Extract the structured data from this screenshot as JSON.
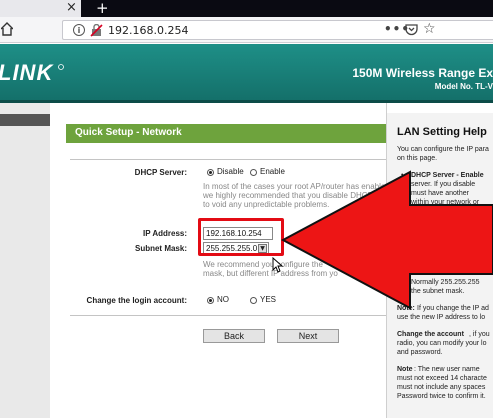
{
  "browser": {
    "tab_close": "×",
    "new_tab": "+",
    "url": "192.168.0.254",
    "more": "•••"
  },
  "banner": {
    "logo": "LINK",
    "product_title": "150M Wireless Range Ex",
    "model": "Model No. TL-V"
  },
  "quick_setup": {
    "title": "Quick Setup - Network",
    "dhcp_label": "DHCP Server:",
    "dhcp_disable": "Disable",
    "dhcp_enable": "Enable",
    "dhcp_selected": "Disable",
    "dhcp_hint": [
      "In most of the cases your root AP/router has enabled",
      "we highly recommended that you disable DHCP",
      "to void any unpredictable problems."
    ],
    "ip_label": "IP Address:",
    "ip_value": "192.168.10.254",
    "mask_label": "Subnet Mask:",
    "mask_value": "255.255.255.0",
    "mask_hint": [
      "We recommend you configure the",
      "mask, but different IP address from yo"
    ],
    "login_label": "Change the login account:",
    "login_no": "NO",
    "login_yes": "YES",
    "login_selected": "NO",
    "back_button": "Back",
    "next_button": "Next"
  },
  "help": {
    "title": "LAN Setting Help",
    "intro": [
      "You can configure the IP para",
      "on this page."
    ],
    "dhcp_bullet": [
      "DHCP Server - Enable",
      "server. If you disable",
      "must have another",
      "within your network or",
      "configure the IP a"
    ],
    "size_lines": [
      "determines the size",
      "Normally 255.255.255",
      "the subnet mask."
    ],
    "note1": [
      "If you change the IP ad",
      "use the new IP address to lo"
    ],
    "account": [
      "Change the account",
      ", if you",
      "radio, you can modify your lo",
      "and password."
    ],
    "note2": [
      "Note",
      ": The new user name",
      "must not exceed 14 characte",
      "must not include any spaces",
      "Password twice to confirm it."
    ],
    "note_prefix": "Note:"
  },
  "colors": {
    "banner": "#1e8f87",
    "header_green": "#6ea33d",
    "highlight_red": "#e30b14"
  }
}
